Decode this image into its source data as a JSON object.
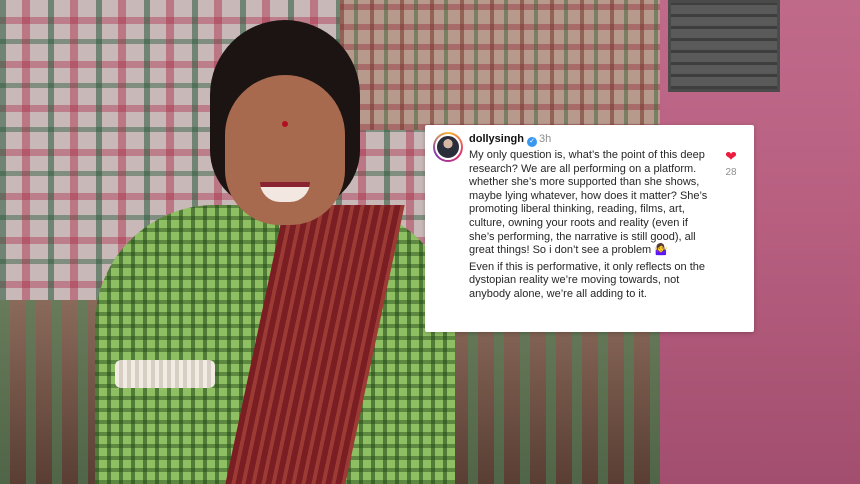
{
  "comment": {
    "username": "dollysingh",
    "time": "3h",
    "verified_icon": "verified-badge-icon",
    "text_p1": "My only question is, what’s the point of this deep research? We are all performing on a platform. whether she’s more supported than she shows, maybe lying whatever, how does it matter? She’s promoting liberal thinking, reading, films, art, culture, owning your roots and reality (even if she’s performing, the narrative is still good), all great things! So i don’t see a problem 🤷‍♀️",
    "text_p2": "Even if this is performative, it only reflects on the dystopian reality we’re moving towards, not anybody alone, we’re all adding to it.",
    "like_icon": "heart-icon",
    "like_count": "28",
    "like_color": "#ed1c3e"
  }
}
